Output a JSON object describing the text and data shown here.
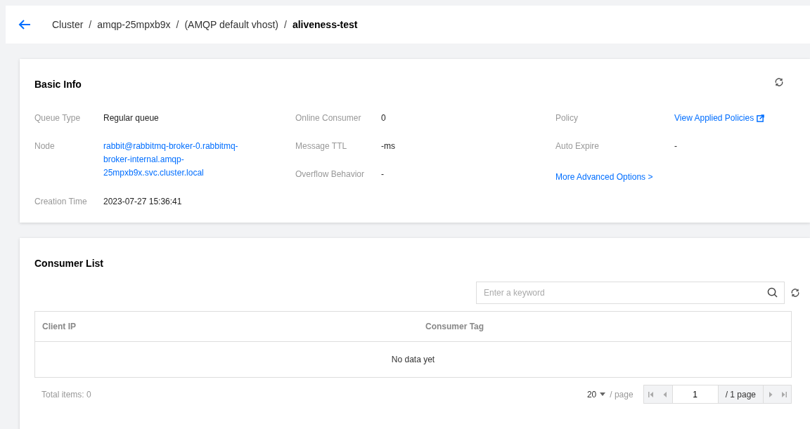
{
  "breadcrumb_separator": "/",
  "breadcrumb": [
    {
      "label": "Cluster",
      "current": false
    },
    {
      "label": "amqp-25mpxb9x",
      "current": false
    },
    {
      "label": "(AMQP default vhost)",
      "current": false
    },
    {
      "label": "aliveness-test",
      "current": true
    }
  ],
  "basic_info": {
    "title": "Basic Info",
    "columns": [
      [
        {
          "label": "Queue Type",
          "value": "Regular queue",
          "kind": "text"
        },
        {
          "label": "Node",
          "value": "rabbit@rabbitmq-broker-0.rabbitmq-broker-internal.amqp-25mpxb9x.svc.cluster.local",
          "kind": "link"
        },
        {
          "label": "Creation Time",
          "value": "2023-07-27 15:36:41",
          "kind": "text"
        }
      ],
      [
        {
          "label": "Online Consumer",
          "value": "0",
          "kind": "text"
        },
        {
          "label": "Message TTL",
          "value": "-ms",
          "kind": "text"
        },
        {
          "label": "Overflow Behavior",
          "value": "-",
          "kind": "text"
        }
      ],
      [
        {
          "label": "Policy",
          "value": "View Applied Policies",
          "kind": "external"
        },
        {
          "label": "Auto Expire",
          "value": "-",
          "kind": "text"
        },
        {
          "label": "More Advanced Options >",
          "kind": "action"
        }
      ]
    ]
  },
  "consumer_list": {
    "title": "Consumer List",
    "search": {
      "placeholder": "Enter a keyword"
    },
    "table": {
      "columns": [
        "Client IP",
        "Consumer Tag"
      ],
      "empty_text": "No data yet"
    },
    "pagination": {
      "total": "Total items: 0",
      "page_size": "20",
      "per_page": "/ page",
      "page": "1",
      "page_count": "/ 1 page"
    }
  }
}
